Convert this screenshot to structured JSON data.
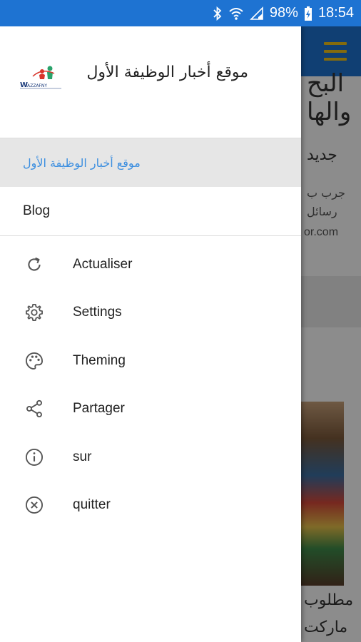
{
  "status_bar": {
    "battery": "98%",
    "time": "18:54",
    "colors": {
      "background": "#1e73d2"
    },
    "icons": [
      "bluetooth-icon",
      "wifi-icon",
      "signal-icon",
      "battery-icon"
    ]
  },
  "background": {
    "appbar_color": "#1e73d2",
    "menu_icon": "hamburger-icon",
    "menu_icon_color": "#f0c419",
    "fragments": [
      "البح",
      "والها",
      "جديد",
      "جرب ب",
      "رسائل",
      "or.com",
      "مطلوب",
      "ماركت"
    ]
  },
  "drawer": {
    "header": {
      "title": "موقع أخبار الوظيفة الأول",
      "logo_icon": "wazzafny-logo"
    },
    "nav": [
      {
        "label": "موقع أخبار الوظيفة الأول",
        "active": true
      },
      {
        "label": "Blog",
        "active": false
      }
    ],
    "menu": [
      {
        "label": "Actualiser",
        "icon": "refresh-icon"
      },
      {
        "label": "Settings",
        "icon": "gear-icon"
      },
      {
        "label": "Theming",
        "icon": "palette-icon"
      },
      {
        "label": "Partager",
        "icon": "share-icon"
      },
      {
        "label": "sur",
        "icon": "info-icon"
      },
      {
        "label": "quitter",
        "icon": "close-circle-icon"
      }
    ],
    "colors": {
      "active_item_text": "#3d8fe0",
      "active_item_bg": "#e6e6e6"
    }
  }
}
